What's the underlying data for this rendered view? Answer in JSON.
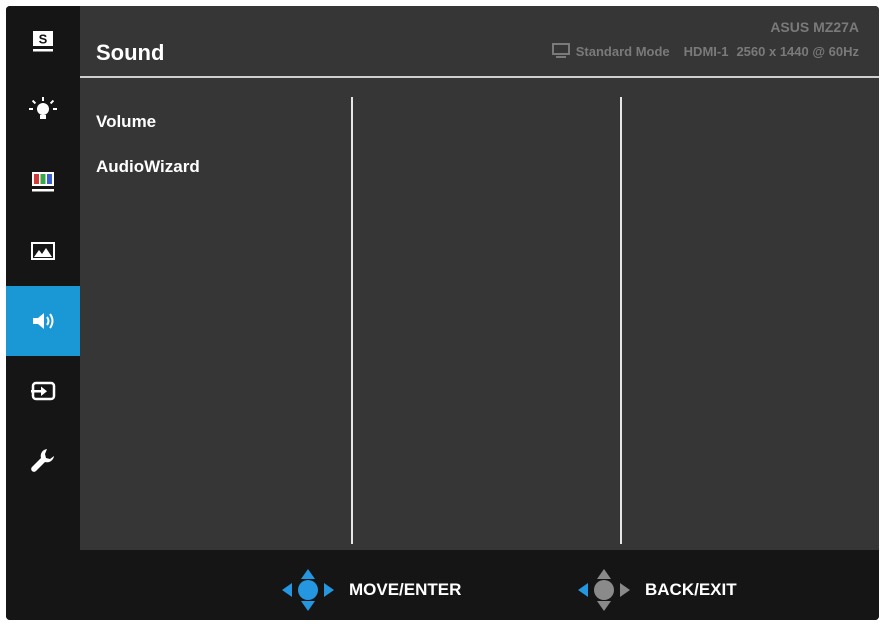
{
  "header": {
    "title": "Sound",
    "model": "ASUS MZ27A",
    "mode": "Standard Mode",
    "input": "HDMI-1",
    "resolution": "2560 x 1440 @ 60Hz"
  },
  "sidebar": {
    "items": [
      {
        "name": "splendid",
        "icon": "splendid-icon",
        "glyph": "S",
        "active": false
      },
      {
        "name": "blue-light-filter",
        "icon": "blue-light-filter-icon",
        "active": false
      },
      {
        "name": "color",
        "icon": "color-icon",
        "active": false
      },
      {
        "name": "image",
        "icon": "image-icon",
        "active": false
      },
      {
        "name": "sound",
        "icon": "speaker-icon",
        "active": true
      },
      {
        "name": "input-select",
        "icon": "input-select-icon",
        "active": false
      },
      {
        "name": "system-setup",
        "icon": "wrench-icon",
        "active": false
      }
    ],
    "active_color": "#1a97d5"
  },
  "menu": {
    "items": [
      "Volume",
      "AudioWizard"
    ]
  },
  "footer": {
    "move_enter": "MOVE/ENTER",
    "back_exit": "BACK/EXIT"
  }
}
